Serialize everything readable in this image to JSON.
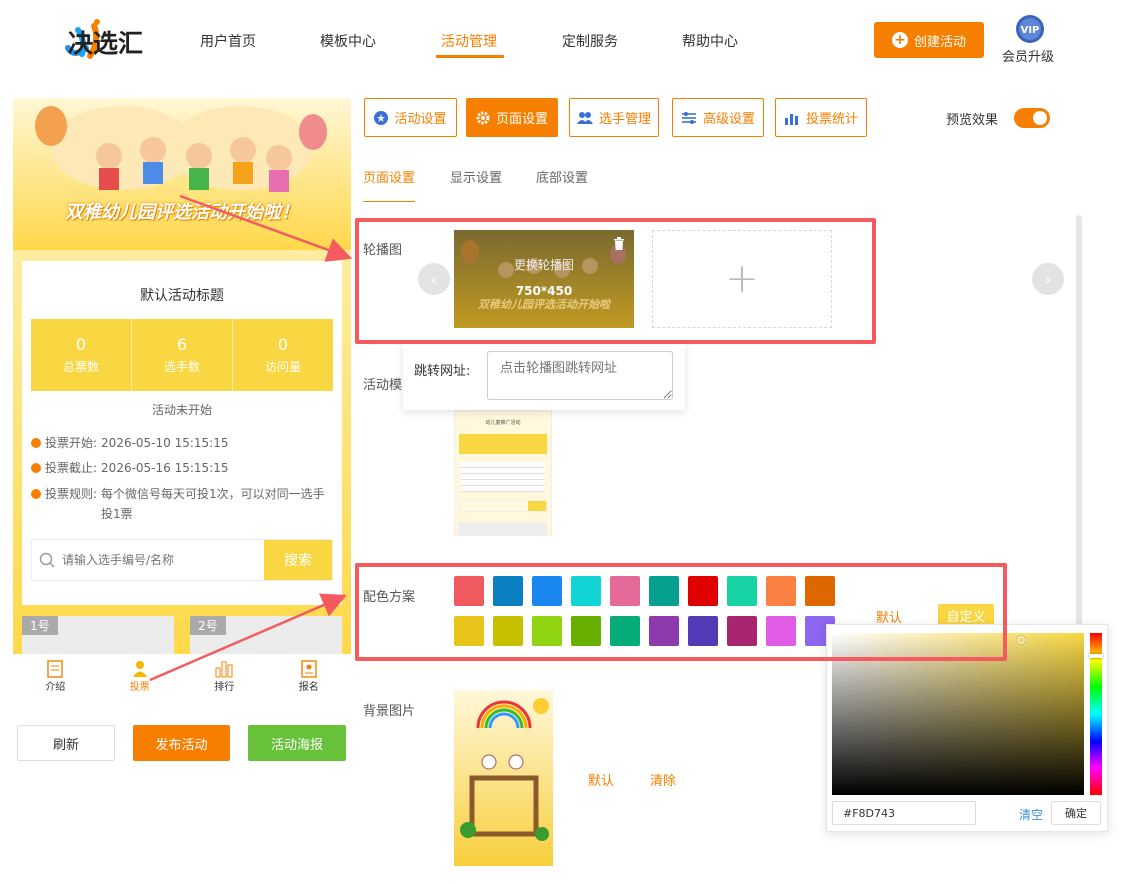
{
  "brand": {
    "name": "决选汇"
  },
  "nav": {
    "items": [
      "用户首页",
      "模板中心",
      "活动管理",
      "定制服务",
      "帮助中心"
    ],
    "active": "活动管理"
  },
  "header": {
    "create_btn": "创建活动",
    "vip_badge": "VIP",
    "vip_label": "会员升级"
  },
  "preview": {
    "banner_title": "双稚幼儿园评选活动开始啦！",
    "activity_title": "默认活动标题",
    "stats": [
      {
        "value": "0",
        "label": "总票数"
      },
      {
        "value": "6",
        "label": "选手数"
      },
      {
        "value": "0",
        "label": "访问量"
      }
    ],
    "status": "活动未开始",
    "info": [
      {
        "label": "投票开始:",
        "value": "2026-05-10 15:15:15"
      },
      {
        "label": "投票截止:",
        "value": "2026-05-16 15:15:15"
      },
      {
        "label": "投票规则:",
        "value": "每个微信号每天可投1次，可以对同一选手投1票"
      }
    ],
    "search_placeholder": "请输入选手编号/名称",
    "search_btn": "搜索",
    "entries": [
      "1号",
      "2号"
    ],
    "tabbar": [
      "介绍",
      "投票",
      "排行",
      "报名"
    ],
    "tabbar_active": "投票"
  },
  "actions": {
    "refresh": "刷新",
    "publish": "发布活动",
    "poster": "活动海报"
  },
  "settings": {
    "top_tabs": [
      "活动设置",
      "页面设置",
      "选手管理",
      "高级设置",
      "投票统计"
    ],
    "top_tab_active": "页面设置",
    "preview_label": "预览效果",
    "preview_on": true,
    "sub_tabs": [
      "页面设置",
      "显示设置",
      "底部设置"
    ],
    "sub_tab_active": "页面设置",
    "carousel": {
      "label": "轮播图",
      "replace_text": "更换轮播图",
      "size_text": "750*450",
      "image_caption": "双稚幼儿园评选活动开始啦",
      "add_symbol": "+",
      "prev": "‹",
      "next": "›"
    },
    "jump": {
      "label": "跳转网址:",
      "placeholder": "点击轮播图跳转网址"
    },
    "template": {
      "label": "活动模",
      "thumb_title": "动儿童推广活动"
    },
    "color_scheme": {
      "label": "配色方案",
      "swatches": [
        "#f05a5e",
        "#0a7fc1",
        "#1a87f1",
        "#13d4d4",
        "#e66a99",
        "#05a090",
        "#e10000",
        "#18d3a3",
        "#fb8142",
        "#de6700",
        "#e8c41a",
        "#c7c000",
        "#8fd311",
        "#67b000",
        "#06ab7a",
        "#8d3aad",
        "#533bb8",
        "#a82670",
        "#e05be6",
        "#8d67f0"
      ],
      "default_btn": "默认",
      "custom_btn": "自定义"
    },
    "background": {
      "label": "背景图片",
      "default_btn": "默认",
      "clear_btn": "清除"
    }
  },
  "color_picker": {
    "value": "#F8D743",
    "clear": "清空",
    "confirm": "确定",
    "hue_color": "#f8d743"
  }
}
